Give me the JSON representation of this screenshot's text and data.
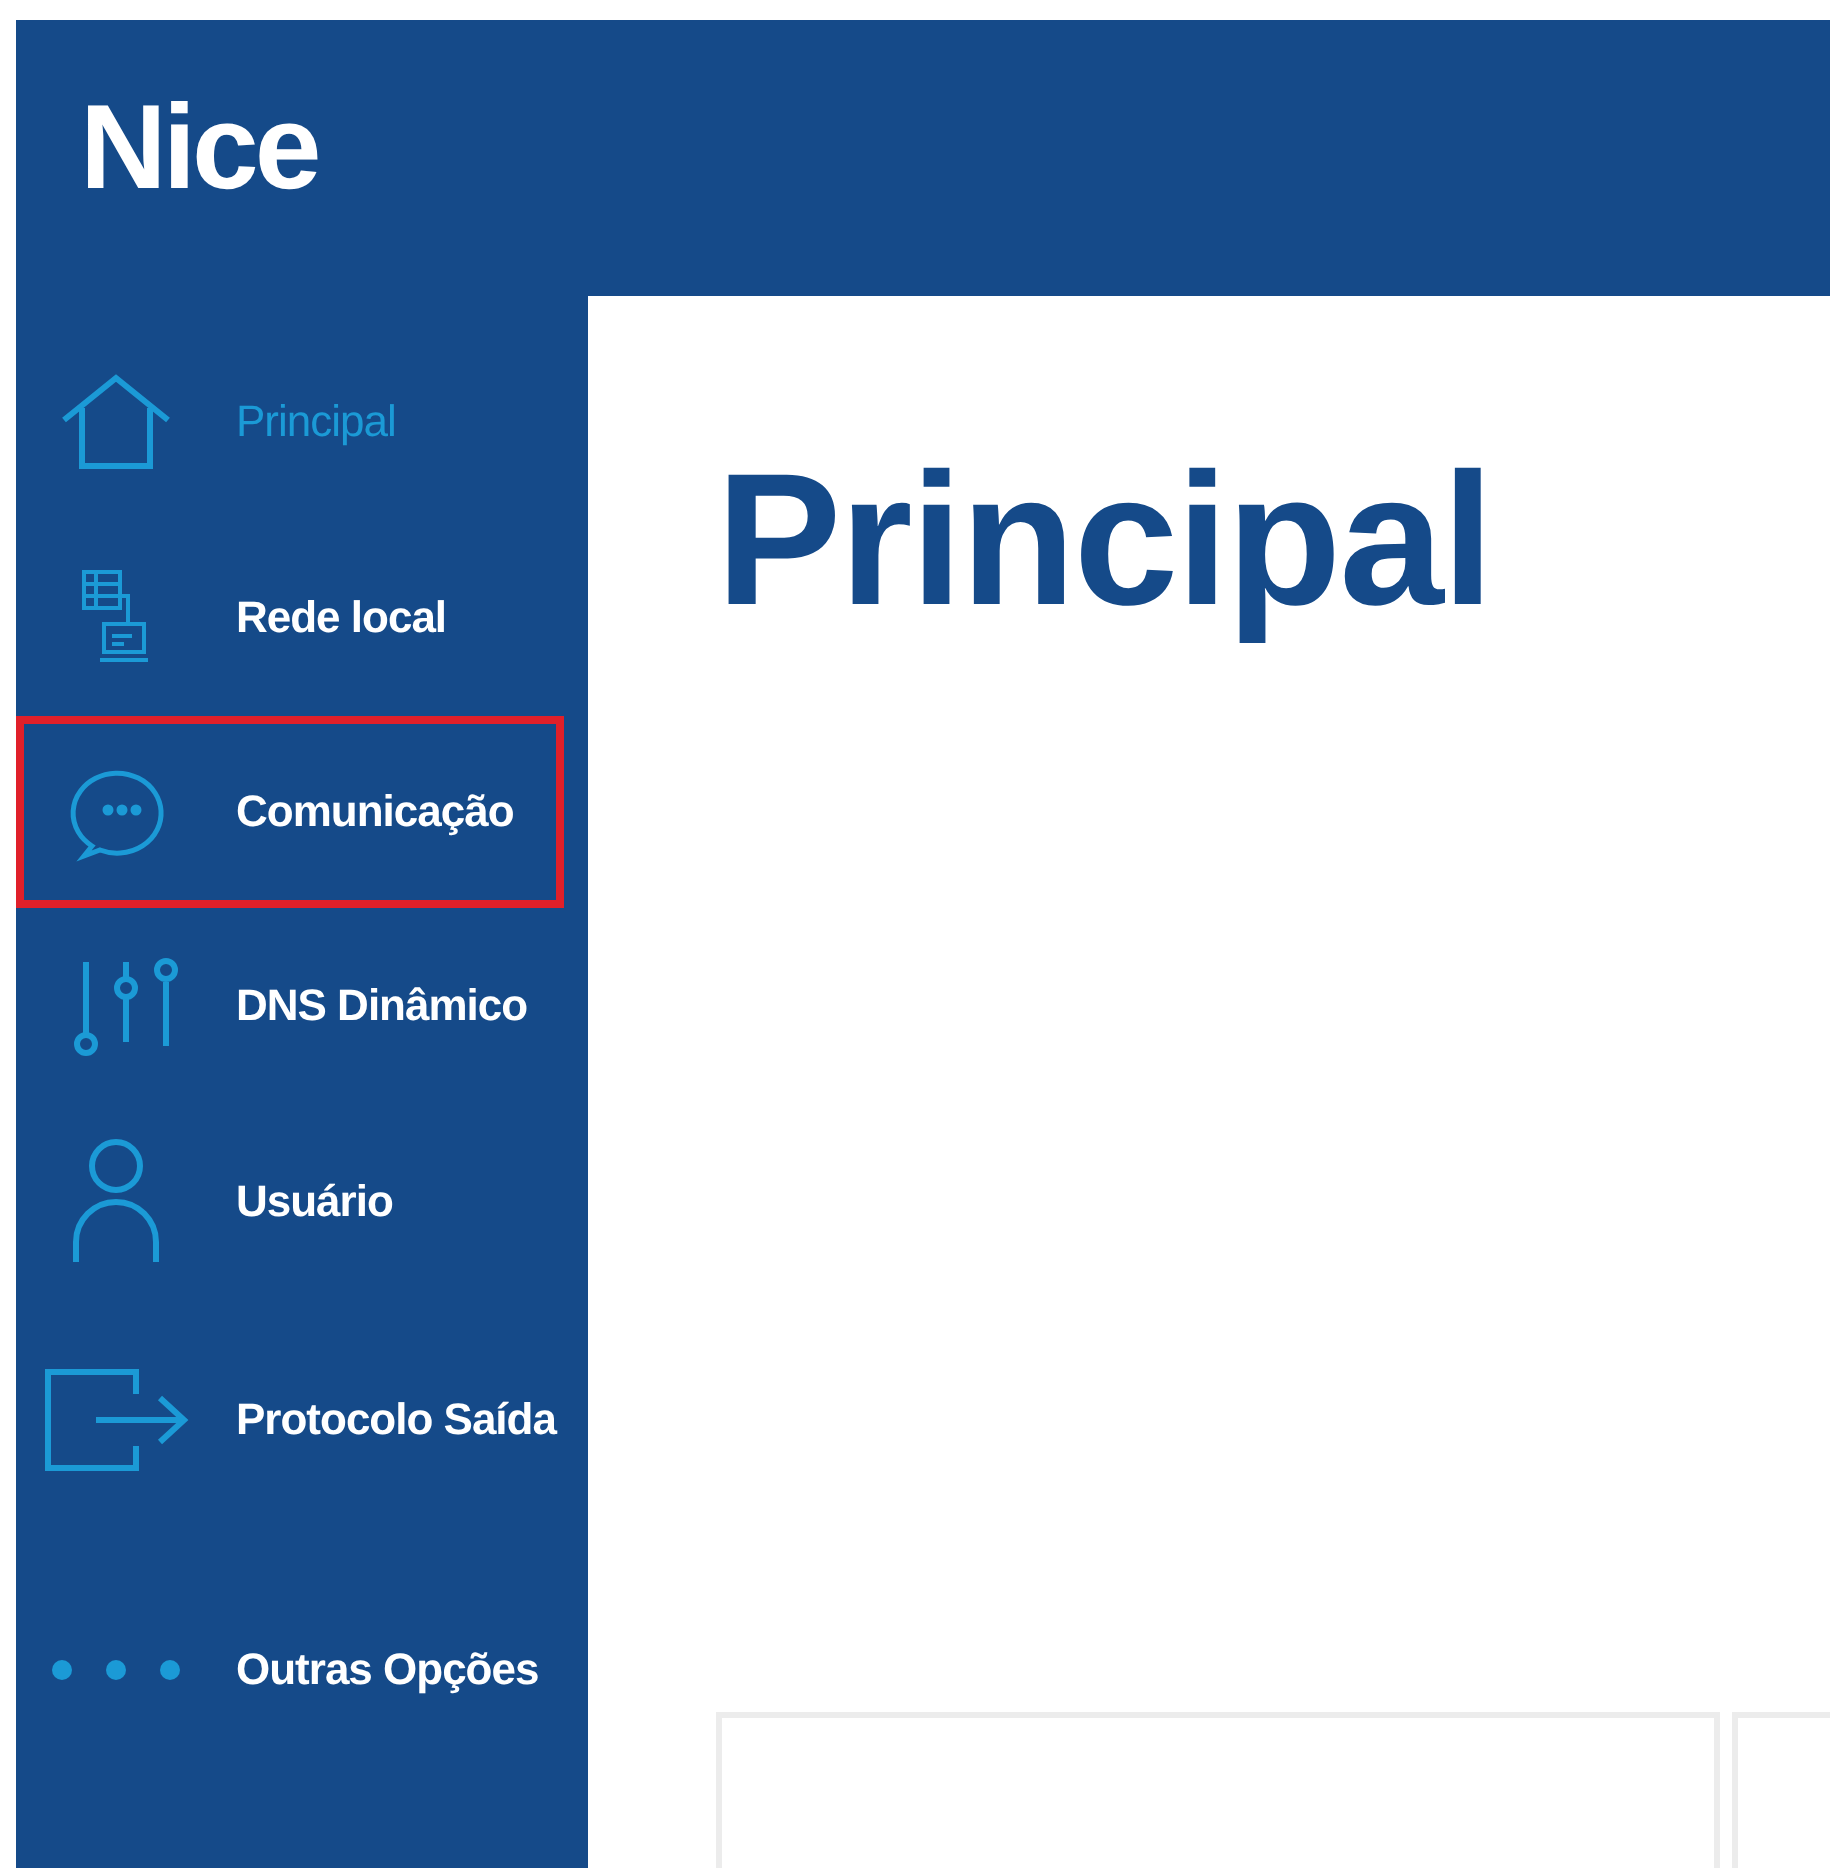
{
  "header": {
    "logo": "Nice"
  },
  "sidebar": {
    "items": [
      {
        "label": "Principal",
        "kind": "home",
        "selected": true,
        "highlighted": false
      },
      {
        "label": "Rede local",
        "kind": "network",
        "selected": false,
        "highlighted": false
      },
      {
        "label": "Comunicação",
        "kind": "chat",
        "selected": false,
        "highlighted": true
      },
      {
        "label": "DNS Dinâmico",
        "kind": "sliders",
        "selected": false,
        "highlighted": false
      },
      {
        "label": "Usuário",
        "kind": "user",
        "selected": false,
        "highlighted": false
      },
      {
        "label": "Protocolo Saída",
        "kind": "exit",
        "selected": false,
        "highlighted": false
      },
      {
        "label": "Outras Opções",
        "kind": "dots",
        "selected": false,
        "highlighted": false
      }
    ]
  },
  "main": {
    "title": "Principal"
  }
}
